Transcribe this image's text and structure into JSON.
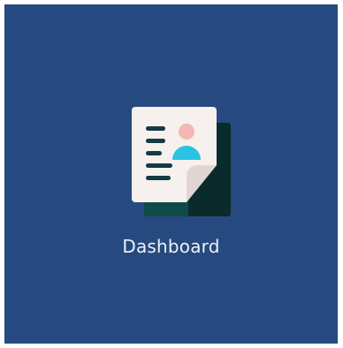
{
  "tile": {
    "label": "Dashboard",
    "icon": "contact-document-icon",
    "background_color": "#264a7f"
  }
}
